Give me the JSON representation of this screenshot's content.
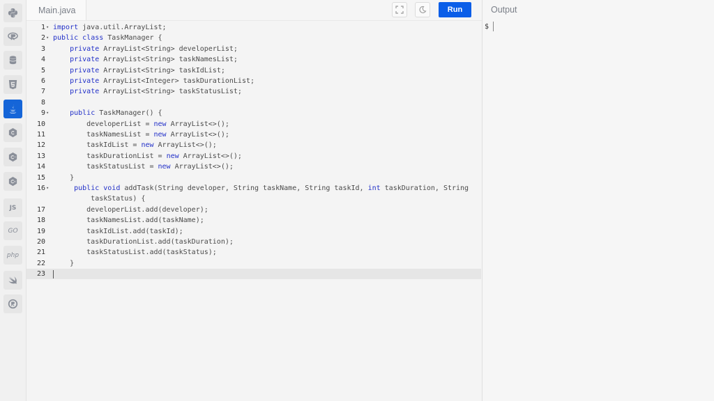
{
  "sidebar": {
    "items": [
      {
        "name": "python",
        "icon": "python-icon"
      },
      {
        "name": "r",
        "icon": "r-icon"
      },
      {
        "name": "sql",
        "icon": "database-icon"
      },
      {
        "name": "html",
        "icon": "html5-icon"
      },
      {
        "name": "java",
        "icon": "java-icon",
        "active": true
      },
      {
        "name": "c",
        "icon": "c-icon"
      },
      {
        "name": "cpp",
        "icon": "cpp-icon"
      },
      {
        "name": "csharp",
        "icon": "csharp-icon"
      },
      {
        "name": "js",
        "icon": "js-icon",
        "label": "JS"
      },
      {
        "name": "go",
        "icon": "go-icon",
        "label": "GO"
      },
      {
        "name": "php",
        "icon": "php-icon",
        "label": "php"
      },
      {
        "name": "swift",
        "icon": "swift-icon"
      },
      {
        "name": "rust",
        "icon": "rust-icon"
      }
    ]
  },
  "editor": {
    "filename": "Main.java",
    "run_label": "Run",
    "lines": [
      {
        "n": "1",
        "fold": true,
        "code": "<k>import</k> java.util.ArrayList;"
      },
      {
        "n": "2",
        "fold": true,
        "code": "<k>public</k> <k>class</k> TaskManager {"
      },
      {
        "n": "3",
        "code": "    <k>private</k> ArrayList&lt;String&gt; developerList;"
      },
      {
        "n": "4",
        "code": "    <k>private</k> ArrayList&lt;String&gt; taskNamesList;"
      },
      {
        "n": "5",
        "code": "    <k>private</k> ArrayList&lt;String&gt; taskIdList;"
      },
      {
        "n": "6",
        "code": "    <k>private</k> ArrayList&lt;Integer&gt; taskDurationList;"
      },
      {
        "n": "7",
        "code": "    <k>private</k> ArrayList&lt;String&gt; taskStatusList;"
      },
      {
        "n": "8",
        "code": ""
      },
      {
        "n": "9",
        "fold": true,
        "code": "    <k>public</k> TaskManager() {"
      },
      {
        "n": "10",
        "code": "        developerList = <k>new</k> ArrayList&lt;&gt;();"
      },
      {
        "n": "11",
        "code": "        taskNamesList = <k>new</k> ArrayList&lt;&gt;();"
      },
      {
        "n": "12",
        "code": "        taskIdList = <k>new</k> ArrayList&lt;&gt;();"
      },
      {
        "n": "13",
        "code": "        taskDurationList = <k>new</k> ArrayList&lt;&gt;();"
      },
      {
        "n": "14",
        "code": "        taskStatusList = <k>new</k> ArrayList&lt;&gt;();"
      },
      {
        "n": "15",
        "code": "    }"
      },
      {
        "n": "16",
        "fold": true,
        "code": "     <k>public</k> <k>void</k> addTask(String developer, String taskName, String taskId, <k>int</k> taskDuration, String"
      },
      {
        "n": "",
        "code": "         taskStatus) {"
      },
      {
        "n": "17",
        "code": "        developerList.add(developer);"
      },
      {
        "n": "18",
        "code": "        taskNamesList.add(taskName);"
      },
      {
        "n": "19",
        "code": "        taskIdList.add(taskId);"
      },
      {
        "n": "20",
        "code": "        taskDurationList.add(taskDuration);"
      },
      {
        "n": "21",
        "code": "        taskStatusList.add(taskStatus);"
      },
      {
        "n": "22",
        "code": "    }"
      },
      {
        "n": "23",
        "code": "",
        "current": true
      }
    ]
  },
  "output": {
    "title": "Output",
    "prompt": "$"
  }
}
